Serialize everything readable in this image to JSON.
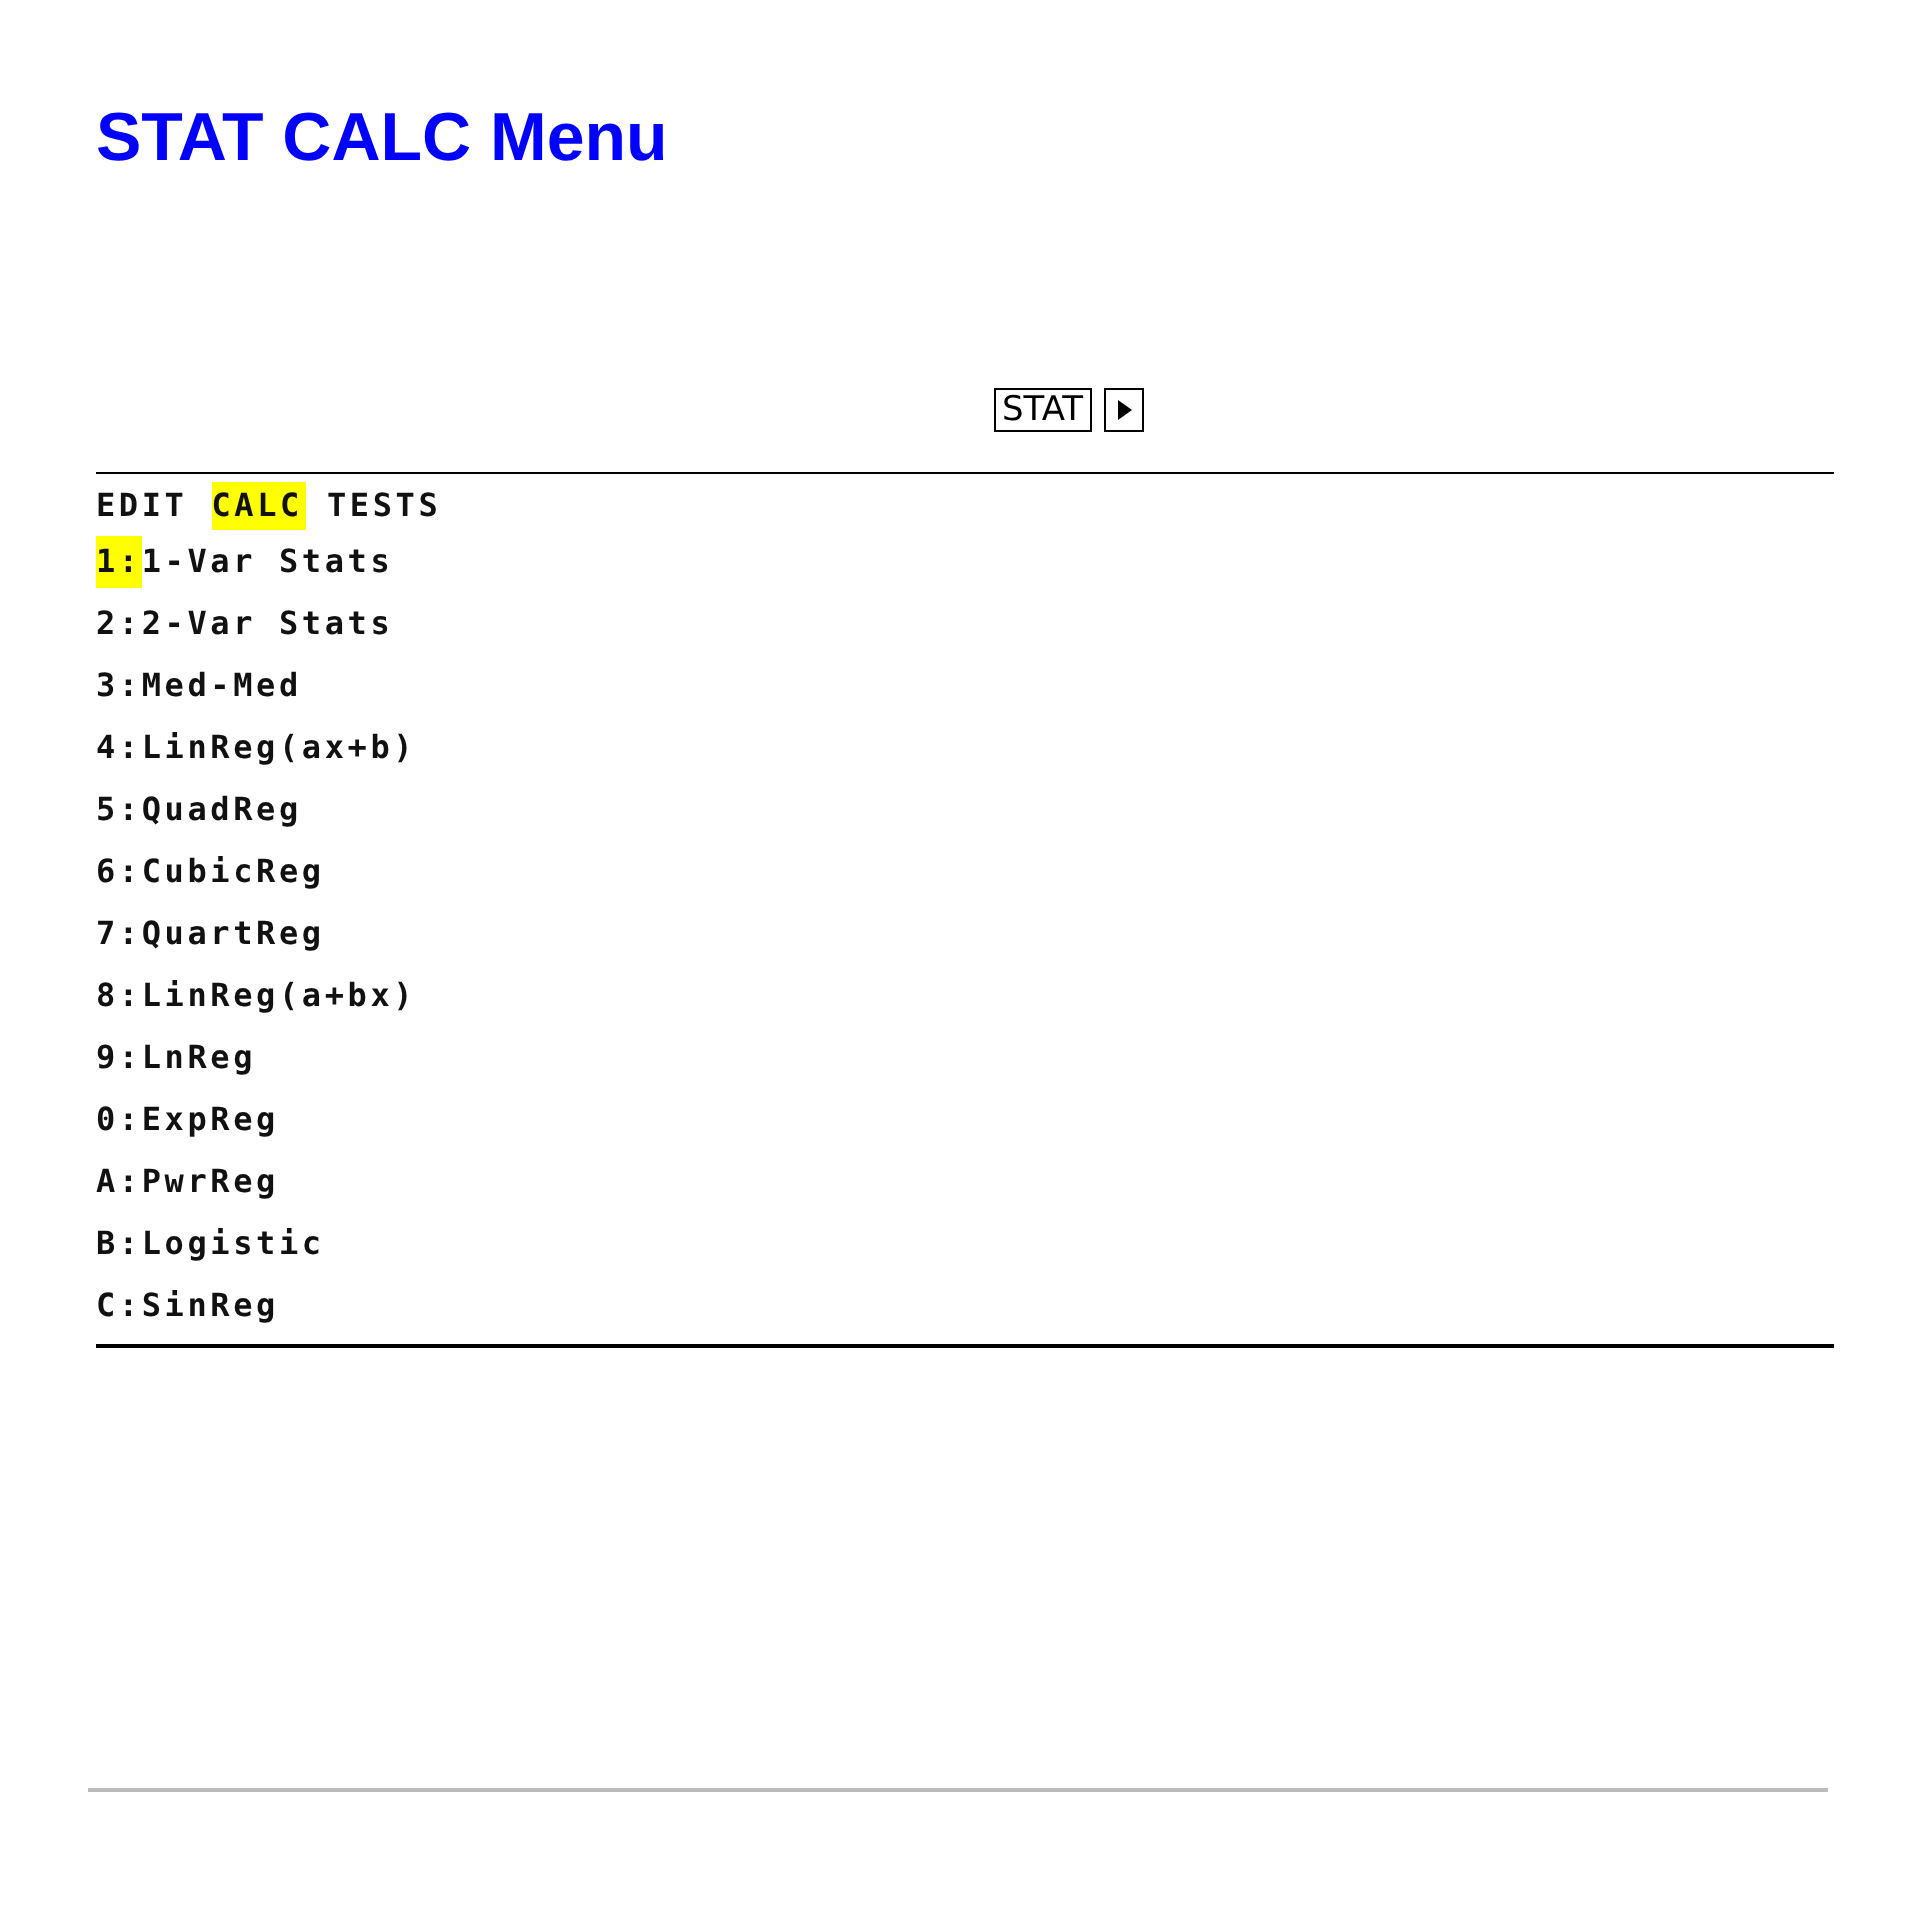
{
  "title": "STAT CALC Menu",
  "keys": [
    {
      "kind": "label",
      "text": "STAT"
    },
    {
      "kind": "arrow-right"
    }
  ],
  "menu": {
    "tabs": [
      {
        "label": "EDIT",
        "selected": false
      },
      {
        "label": "CALC",
        "selected": true
      },
      {
        "label": "TESTS",
        "selected": false
      }
    ],
    "items": [
      {
        "number": "1:",
        "label": "1-Var Stats",
        "selected": true
      },
      {
        "number": "2:",
        "label": "2-Var Stats",
        "selected": false
      },
      {
        "number": "3:",
        "label": "Med-Med",
        "selected": false
      },
      {
        "number": "4:",
        "label": "LinReg(ax+b)",
        "selected": false
      },
      {
        "number": "5:",
        "label": "QuadReg",
        "selected": false
      },
      {
        "number": "6:",
        "label": "CubicReg",
        "selected": false
      },
      {
        "number": "7:",
        "label": "QuartReg",
        "selected": false
      },
      {
        "number": "8:",
        "label": "LinReg(a+bx)",
        "selected": false
      },
      {
        "number": "9:",
        "label": "LnReg",
        "selected": false
      },
      {
        "number": "0:",
        "label": "ExpReg",
        "selected": false
      },
      {
        "number": "A:",
        "label": "PwrReg",
        "selected": false
      },
      {
        "number": "B:",
        "label": "Logistic",
        "selected": false
      },
      {
        "number": "C:",
        "label": "SinReg",
        "selected": false
      }
    ]
  }
}
